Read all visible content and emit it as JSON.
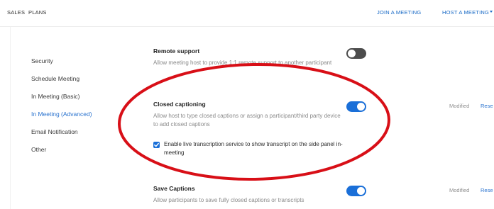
{
  "topbar": {
    "sales": "SALES",
    "plans": "PLANS",
    "join": "JOIN A MEETING",
    "host": "HOST A MEETING"
  },
  "sidebar": {
    "items": [
      {
        "label": "Security"
      },
      {
        "label": "Schedule Meeting"
      },
      {
        "label": "In Meeting (Basic)"
      },
      {
        "label": "In Meeting (Advanced)",
        "active": true
      },
      {
        "label": "Email Notification"
      },
      {
        "label": "Other"
      }
    ]
  },
  "settings": {
    "remote_support": {
      "title": "Remote support",
      "description": "Allow meeting host to provide 1:1 remote support to another participant",
      "enabled": false
    },
    "closed_captioning": {
      "title": "Closed captioning",
      "description": "Allow host to type closed captions or assign a participant/third party device to add closed captions",
      "enabled": true,
      "status": "Modified",
      "reset_label": "Rese",
      "option": {
        "checked": true,
        "label": "Enable live transcription service to show transcript on the side panel in-meeting"
      }
    },
    "save_captions": {
      "title": "Save Captions",
      "description": "Allow participants to save fully closed captions or transcripts",
      "enabled": true,
      "status": "Modified",
      "reset_label": "Rese"
    }
  },
  "colors": {
    "accent": "#1a6fd8",
    "link": "#1668c5",
    "toggle_off": "#4c4c4c",
    "annotation": "#d80f17"
  },
  "icons": {
    "checkbox": "checkmark-icon",
    "host_caret": "chevron-down-icon"
  }
}
